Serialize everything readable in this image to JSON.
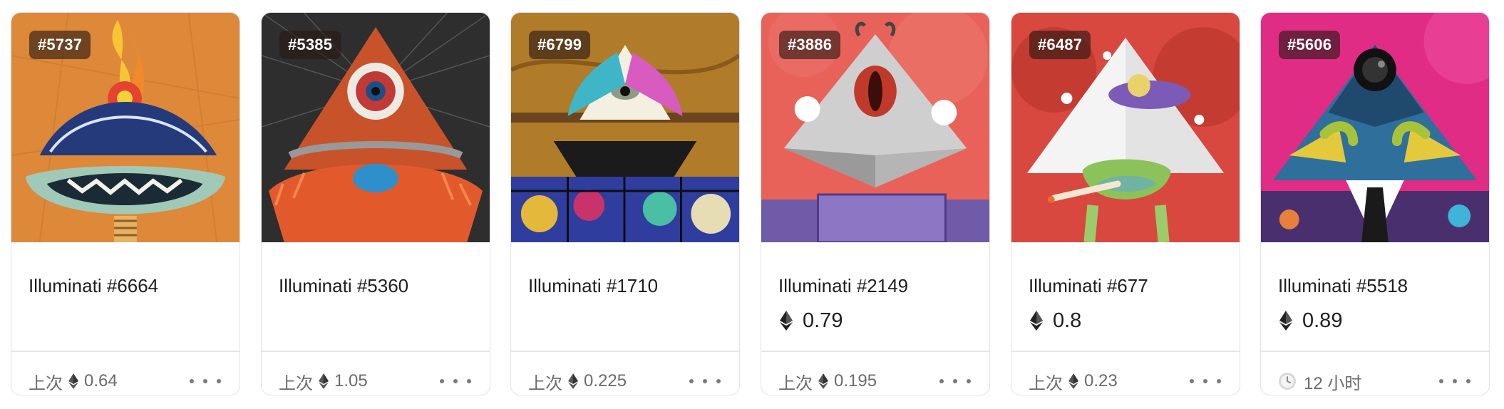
{
  "cards": [
    {
      "badge": "#5737",
      "title": "Illuminati #6664",
      "price": "",
      "footer_label": "上次",
      "footer_value": "0.64",
      "footer_kind": "last",
      "bg": "#E8913E"
    },
    {
      "badge": "#5385",
      "title": "Illuminati #5360",
      "price": "",
      "footer_label": "上次",
      "footer_value": "1.05",
      "footer_kind": "last",
      "bg": "#3A3A3A"
    },
    {
      "badge": "#6799",
      "title": "Illuminati #1710",
      "price": "",
      "footer_label": "上次",
      "footer_value": "0.225",
      "footer_kind": "last",
      "bg": "#B8862E"
    },
    {
      "badge": "#3886",
      "title": "Illuminati #2149",
      "price": "0.79",
      "footer_label": "上次",
      "footer_value": "0.195",
      "footer_kind": "last",
      "bg": "#E8625A"
    },
    {
      "badge": "#6487",
      "title": "Illuminati #677",
      "price": "0.8",
      "footer_label": "上次",
      "footer_value": "0.23",
      "footer_kind": "last",
      "bg": "#D94A3F"
    },
    {
      "badge": "#5606",
      "title": "Illuminati #5518",
      "price": "0.89",
      "footer_label": "12 小时",
      "footer_value": "",
      "footer_kind": "time",
      "bg": "#E32E86"
    }
  ],
  "icons": {
    "currency": "ethereum-icon",
    "time": "clock-icon",
    "menu": "more-options-icon"
  },
  "colors": {
    "text_primary": "#1F1F1F",
    "text_secondary": "#6B6B6B",
    "border": "#E3E3E3"
  }
}
